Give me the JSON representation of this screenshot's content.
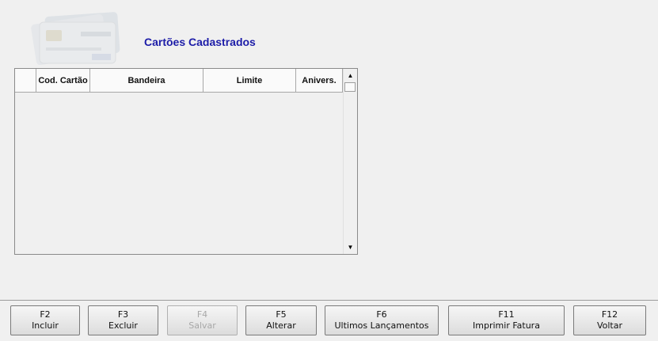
{
  "window": {
    "title": "Cartões Cadastrados",
    "logo_icon": "credit-cards-icon"
  },
  "grid": {
    "columns": [
      "",
      "Cod. Cartão",
      "Bandeira",
      "Limite",
      "Anivers."
    ],
    "rows": []
  },
  "toolbar": {
    "buttons": [
      {
        "key": "F2",
        "label": "Incluir",
        "enabled": true
      },
      {
        "key": "F3",
        "label": "Excluir",
        "enabled": true
      },
      {
        "key": "F4",
        "label": "Salvar",
        "enabled": false
      },
      {
        "key": "F5",
        "label": "Alterar",
        "enabled": true
      },
      {
        "key": "F6",
        "label": "Ultimos Lançamentos",
        "enabled": true
      },
      {
        "key": "F11",
        "label": "Imprimir Fatura",
        "enabled": true
      },
      {
        "key": "F12",
        "label": "Voltar",
        "enabled": true
      }
    ]
  },
  "colors": {
    "title": "#1c1ca8",
    "background": "#f0f0f0"
  }
}
